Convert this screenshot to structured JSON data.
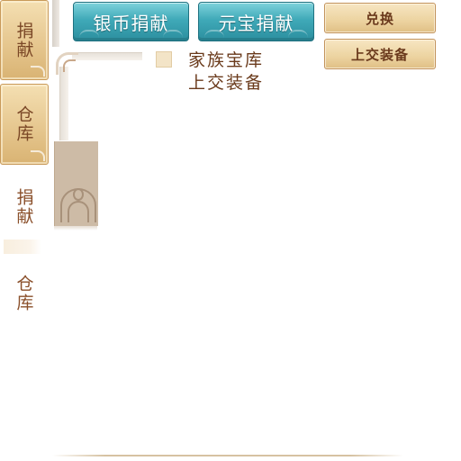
{
  "side_tabs": [
    {
      "label": "捐献",
      "state": "active-gold"
    },
    {
      "label": "仓库",
      "state": "gold"
    },
    {
      "label": "捐献",
      "state": "plain"
    },
    {
      "label": "仓库",
      "state": "plain"
    }
  ],
  "top_buttons": {
    "silver_donate": "银币捐献",
    "ingot_donate": "元宝捐献"
  },
  "right_buttons": {
    "exchange": "兑换",
    "submit_equipment": "上交装备"
  },
  "panel": {
    "checkbox_label_line1": "家族宝库",
    "checkbox_label_line2": "上交装备"
  },
  "colors": {
    "blue_button": "#3fa9b8",
    "gold_button": "#ecd3a0",
    "text_brown": "#6a3a1b"
  }
}
